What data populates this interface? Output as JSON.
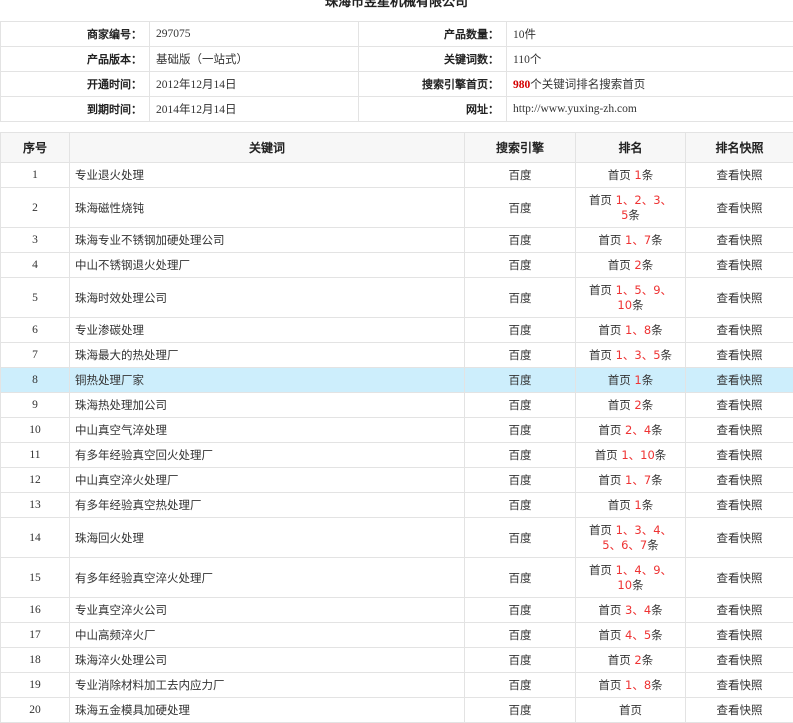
{
  "page_title": "珠海市昱星机械有限公司",
  "info": [
    {
      "label_a": "商家编号：",
      "value_a": "297075",
      "label_b": "产品数量：",
      "value_b": "10件"
    },
    {
      "label_a": "产品版本：",
      "value_a": "基础版（一站式）",
      "label_b": "关键词数：",
      "value_b": "110个"
    },
    {
      "label_a": "开通时间：",
      "value_a": "2012年12月14日",
      "label_b": "搜索引擎首页：",
      "value_b_highlight": "980",
      "value_b": "个关键词排名搜索首页"
    },
    {
      "label_a": "到期时间：",
      "value_a": "2014年12月14日",
      "label_b": "网址：",
      "value_b": "http://www.yuxing-zh.com"
    }
  ],
  "columns": [
    "序号",
    "关键词",
    "搜索引擎",
    "排名",
    "排名快照"
  ],
  "rows": [
    {
      "no": "1",
      "keyword": "专业退火处理",
      "engine": "百度",
      "rank_prefix": "首页",
      "rank_positions": "1",
      "rank_suffix": "条",
      "snapshot": "查看快照",
      "h": 25
    },
    {
      "no": "2",
      "keyword": "珠海磁性烧钝",
      "engine": "百度",
      "rank_prefix": "首页",
      "rank_positions": "1、2、3、5",
      "rank_suffix": "条",
      "snapshot": "查看快照",
      "h": 40
    },
    {
      "no": "3",
      "keyword": "珠海专业不锈钢加硬处理公司",
      "engine": "百度",
      "rank_prefix": "首页",
      "rank_positions": "1、7",
      "rank_suffix": "条",
      "snapshot": "查看快照",
      "h": 25
    },
    {
      "no": "4",
      "keyword": "中山不锈钢退火处理厂",
      "engine": "百度",
      "rank_prefix": "首页",
      "rank_positions": "2",
      "rank_suffix": "条",
      "snapshot": "查看快照",
      "h": 25
    },
    {
      "no": "5",
      "keyword": "珠海时效处理公司",
      "engine": "百度",
      "rank_prefix": "首页",
      "rank_positions": "1、5、9、10",
      "rank_suffix": "条",
      "snapshot": "查看快照",
      "h": 40
    },
    {
      "no": "6",
      "keyword": "专业渗碳处理",
      "engine": "百度",
      "rank_prefix": "首页",
      "rank_positions": "1、8",
      "rank_suffix": "条",
      "snapshot": "查看快照",
      "h": 25
    },
    {
      "no": "7",
      "keyword": "珠海最大的热处理厂",
      "engine": "百度",
      "rank_prefix": "首页",
      "rank_positions": "1、3、5",
      "rank_suffix": "条",
      "snapshot": "查看快照",
      "h": 25
    },
    {
      "no": "8",
      "keyword": "铜热处理厂家",
      "engine": "百度",
      "rank_prefix": "首页",
      "rank_positions": "1",
      "rank_suffix": "条",
      "snapshot": "查看快照",
      "h": 25,
      "selected": true
    },
    {
      "no": "9",
      "keyword": "珠海热处理加公司",
      "engine": "百度",
      "rank_prefix": "首页",
      "rank_positions": "2",
      "rank_suffix": "条",
      "snapshot": "查看快照",
      "h": 25
    },
    {
      "no": "10",
      "keyword": "中山真空气淬处理",
      "engine": "百度",
      "rank_prefix": "首页",
      "rank_positions": "2、4",
      "rank_suffix": "条",
      "snapshot": "查看快照",
      "h": 25
    },
    {
      "no": "11",
      "keyword": "有多年经验真空回火处理厂",
      "engine": "百度",
      "rank_prefix": "首页",
      "rank_positions": "1、10",
      "rank_suffix": "条",
      "snapshot": "查看快照",
      "h": 25
    },
    {
      "no": "12",
      "keyword": "中山真空淬火处理厂",
      "engine": "百度",
      "rank_prefix": "首页",
      "rank_positions": "1、7",
      "rank_suffix": "条",
      "snapshot": "查看快照",
      "h": 25
    },
    {
      "no": "13",
      "keyword": "有多年经验真空热处理厂",
      "engine": "百度",
      "rank_prefix": "首页",
      "rank_positions": "1",
      "rank_suffix": "条",
      "snapshot": "查看快照",
      "h": 25
    },
    {
      "no": "14",
      "keyword": "珠海回火处理",
      "engine": "百度",
      "rank_prefix": "首页",
      "rank_positions": "1、3、4、5、6、7",
      "rank_suffix": "条",
      "snapshot": "查看快照",
      "h": 40
    },
    {
      "no": "15",
      "keyword": "有多年经验真空淬火处理厂",
      "engine": "百度",
      "rank_prefix": "首页",
      "rank_positions": "1、4、9、10",
      "rank_suffix": "条",
      "snapshot": "查看快照",
      "h": 40
    },
    {
      "no": "16",
      "keyword": "专业真空淬火公司",
      "engine": "百度",
      "rank_prefix": "首页",
      "rank_positions": "3、4",
      "rank_suffix": "条",
      "snapshot": "查看快照",
      "h": 25
    },
    {
      "no": "17",
      "keyword": "中山高频淬火厂",
      "engine": "百度",
      "rank_prefix": "首页",
      "rank_positions": "4、5",
      "rank_suffix": "条",
      "snapshot": "查看快照",
      "h": 25
    },
    {
      "no": "18",
      "keyword": "珠海淬火处理公司",
      "engine": "百度",
      "rank_prefix": "首页",
      "rank_positions": "2",
      "rank_suffix": "条",
      "snapshot": "查看快照",
      "h": 25
    },
    {
      "no": "19",
      "keyword": "专业消除材料加工去内应力厂",
      "engine": "百度",
      "rank_prefix": "首页",
      "rank_positions": "1、8",
      "rank_suffix": "条",
      "snapshot": "查看快照",
      "h": 25
    },
    {
      "no": "20",
      "keyword": "珠海五金模具加硬处理",
      "engine": "百度",
      "rank_prefix": "首页",
      "rank_positions": "",
      "rank_suffix": "",
      "snapshot": "查看快照",
      "h": 25
    }
  ]
}
